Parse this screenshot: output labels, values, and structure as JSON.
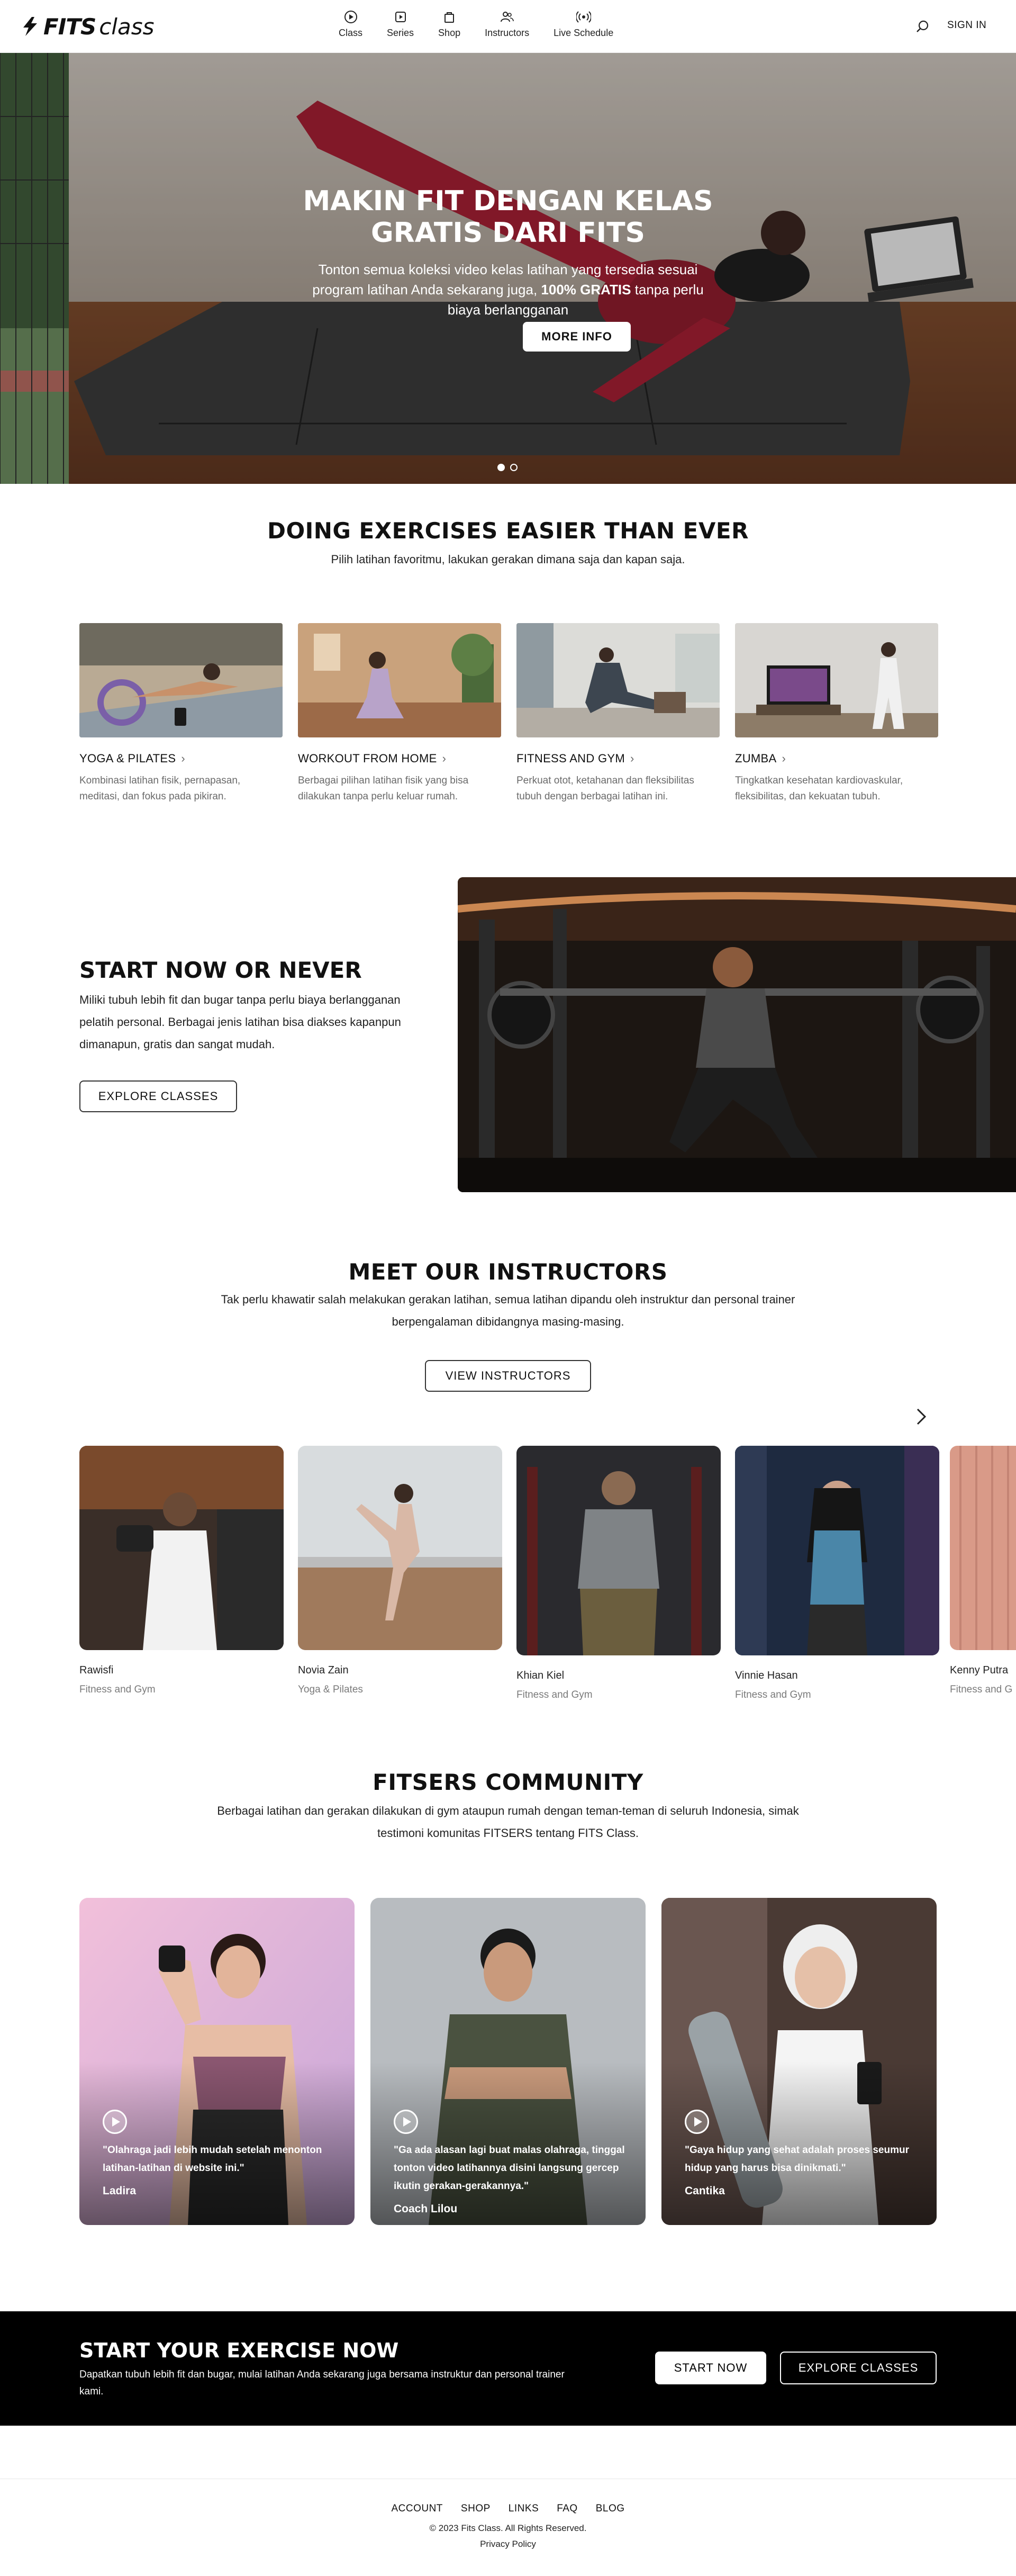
{
  "header": {
    "logo_fits": "FITS",
    "logo_class": "class",
    "nav": [
      {
        "label": "Class",
        "icon": "play-circle-icon"
      },
      {
        "label": "Series",
        "icon": "series-icon"
      },
      {
        "label": "Shop",
        "icon": "shopping-bag-icon"
      },
      {
        "label": "Instructors",
        "icon": "instructors-icon"
      },
      {
        "label": "Live Schedule",
        "icon": "live-broadcast-icon"
      }
    ],
    "sign_in": "SIGN IN"
  },
  "hero": {
    "title": "MAKIN FIT DENGAN KELAS GRATIS DARI FITS",
    "subtitle_before": "Tonton semua koleksi video kelas latihan yang tersedia sesuai program latihan Anda sekarang juga,",
    "subtitle_bold": "100% GRATIS",
    "subtitle_after": "tanpa perlu biaya berlangganan",
    "button": "MORE INFO",
    "active_slide": 1,
    "slide_count": 2
  },
  "exercises": {
    "title": "DOING EXERCISES EASIER THAN EVER",
    "subtitle": "Pilih latihan favoritmu, lakukan gerakan dimana saja dan kapan saja.",
    "categories": [
      {
        "name": "YOGA & PILATES",
        "desc": "Kombinasi latihan fisik, pernapasan, meditasi, dan fokus pada pikiran."
      },
      {
        "name": "WORKOUT FROM HOME",
        "desc": "Berbagai pilihan latihan fisik yang bisa dilakukan tanpa perlu keluar rumah."
      },
      {
        "name": "FITNESS AND GYM",
        "desc": "Perkuat otot, ketahanan dan fleksibilitas tubuh dengan berbagai latihan ini."
      },
      {
        "name": "ZUMBA",
        "desc": "Tingkatkan kesehatan kardiovaskular, fleksibilitas, dan kekuatan tubuh."
      }
    ]
  },
  "start_now": {
    "title": "START NOW OR NEVER",
    "text": "Miliki tubuh lebih fit dan bugar tanpa perlu biaya berlangganan pelatih personal. Berbagai jenis latihan bisa diakses kapanpun dimanapun, gratis dan sangat mudah.",
    "button": "EXPLORE CLASSES"
  },
  "instructors": {
    "title": "MEET OUR INSTRUCTORS",
    "subtitle": "Tak perlu khawatir salah melakukan gerakan latihan, semua latihan dipandu oleh instruktur dan personal trainer berpengalaman dibidangnya masing-masing.",
    "button": "VIEW INSTRUCTORS",
    "list": [
      {
        "name": "Rawisfi",
        "category": "Fitness and Gym"
      },
      {
        "name": "Novia Zain",
        "category": "Yoga & Pilates"
      },
      {
        "name": "Khian Kiel",
        "category": "Fitness and Gym"
      },
      {
        "name": "Vinnie Hasan",
        "category": "Fitness and Gym"
      },
      {
        "name": "Kenny Putra",
        "category": "Fitness and G"
      }
    ]
  },
  "community": {
    "title": "FITSERS COMMUNITY",
    "subtitle": "Berbagai latihan dan gerakan dilakukan di gym ataupun rumah dengan teman-teman di seluruh Indonesia, simak testimoni komunitas FITSERS tentang FITS Class.",
    "testimonials": [
      {
        "quote": "\"Olahraga jadi lebih mudah setelah menonton latihan-latihan di website ini.\"",
        "name": "Ladira"
      },
      {
        "quote": "\"Ga ada alasan lagi buat malas olahraga, tinggal tonton video latihannya disini langsung gercep ikutin gerakan-gerakannya.\"",
        "name": "Coach Lilou"
      },
      {
        "quote": "\"Gaya hidup yang sehat adalah proses seumur hidup yang harus bisa dinikmati.\"",
        "name": "Cantika"
      }
    ]
  },
  "cta": {
    "title": "START YOUR EXERCISE NOW",
    "text": "Dapatkan tubuh lebih fit dan bugar, mulai latihan Anda sekarang juga bersama instruktur dan personal trainer kami.",
    "button_primary": "START NOW",
    "button_secondary": "EXPLORE CLASSES"
  },
  "footer": {
    "links": [
      "ACCOUNT",
      "SHOP",
      "LINKS",
      "FAQ",
      "BLOG"
    ],
    "copyright": "© 2023 Fits Class. All Rights Reserved.",
    "privacy": "Privacy Policy"
  }
}
